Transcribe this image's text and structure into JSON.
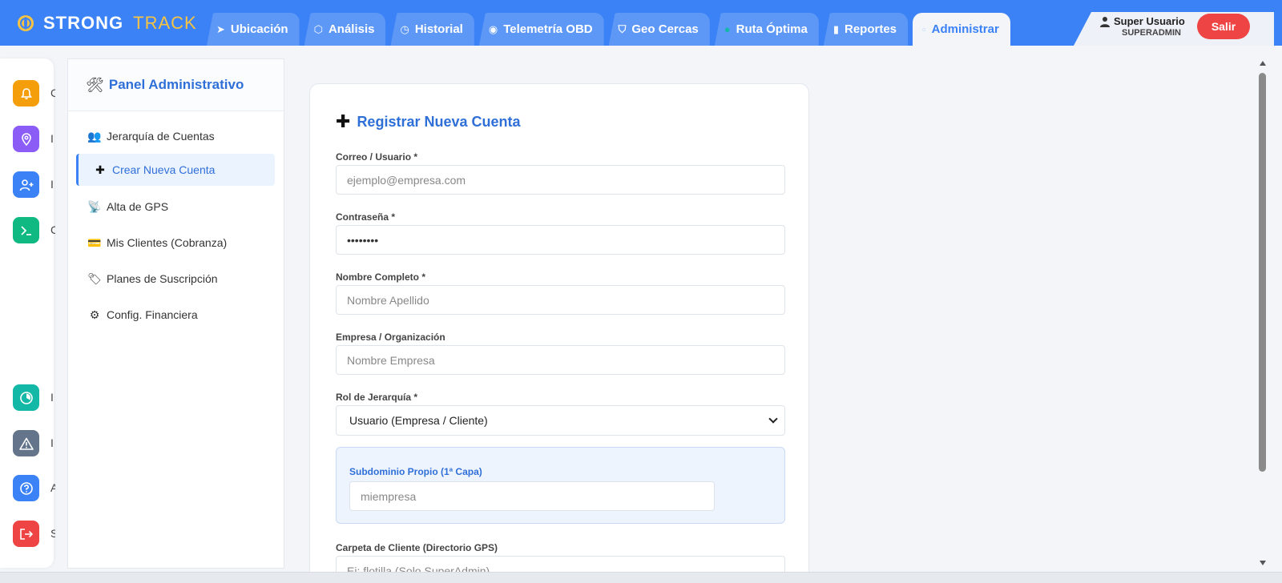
{
  "brand": {
    "part1": "STRONG",
    "part2": "TRACK"
  },
  "tabs": [
    {
      "label": "Ubicación",
      "icon": "send-icon",
      "glyph": "➤"
    },
    {
      "label": "Análisis",
      "icon": "cube-icon",
      "glyph": "⬡"
    },
    {
      "label": "Historial",
      "icon": "clock-icon",
      "glyph": "◷"
    },
    {
      "label": "Telemetría OBD",
      "icon": "gauge-icon",
      "glyph": "◉"
    },
    {
      "label": "Geo Cercas",
      "icon": "shield-icon",
      "glyph": "⛉"
    },
    {
      "label": "Ruta Óptima",
      "icon": "route-icon",
      "glyph": "●"
    },
    {
      "label": "Reportes",
      "icon": "bar-chart-icon",
      "glyph": "▮"
    },
    {
      "label": "Administrar",
      "icon": "admin-icon",
      "glyph": "▫"
    }
  ],
  "user": {
    "name": "Super Usuario",
    "role": "SUPERADMIN",
    "logout_label": "Salir"
  },
  "rail": [
    {
      "icon": "bell-icon",
      "color": "#f59e0b",
      "glyph": "♪"
    },
    {
      "icon": "location-pin-icon",
      "color": "#8b5cf6",
      "glyph": "◎"
    },
    {
      "icon": "user-plus-icon",
      "color": "#3b82f6",
      "glyph": "+"
    },
    {
      "icon": "terminal-icon",
      "color": "#10b981",
      "glyph": "›_"
    },
    {
      "icon": "timer-icon",
      "color": "#14b8a6",
      "glyph": "◔"
    },
    {
      "icon": "warning-icon",
      "color": "#64748b",
      "glyph": "⚠"
    },
    {
      "icon": "help-icon",
      "color": "#3b82f6",
      "glyph": "?"
    },
    {
      "icon": "logout-icon",
      "color": "#ef4444",
      "glyph": "⇥"
    }
  ],
  "panel": {
    "title": "Panel Administrativo",
    "items": [
      {
        "label": "Jerarquía de Cuentas",
        "icon": "users-icon",
        "glyph": "👥"
      },
      {
        "label": "Crear Nueva Cuenta",
        "icon": "plus-icon",
        "glyph": "✚"
      },
      {
        "label": "Alta de GPS",
        "icon": "satellite-icon",
        "glyph": "📡"
      },
      {
        "label": "Mis Clientes (Cobranza)",
        "icon": "credit-card-icon",
        "glyph": "💳"
      },
      {
        "label": "Planes de Suscripción",
        "icon": "tag-icon",
        "glyph": "🏷"
      },
      {
        "label": "Config. Financiera",
        "icon": "gear-icon",
        "glyph": "⚙"
      }
    ]
  },
  "form": {
    "title": "Registrar Nueva Cuenta",
    "email_label": "Correo / Usuario *",
    "email_placeholder": "ejemplo@empresa.com",
    "password_label": "Contraseña *",
    "password_value": "abcdefgh",
    "name_label": "Nombre Completo *",
    "name_placeholder": "Nombre Apellido",
    "company_label": "Empresa / Organización",
    "company_placeholder": "Nombre Empresa",
    "role_label": "Rol de Jerarquía *",
    "role_value": "Usuario (Empresa / Cliente)",
    "subdomain_label": "Subdominio Propio (1ª Capa)",
    "subdomain_placeholder": "miempresa",
    "folder_label": "Carpeta de Cliente (Directorio GPS)",
    "folder_placeholder": "Ej: flotilla (Solo SuperAdmin)"
  }
}
